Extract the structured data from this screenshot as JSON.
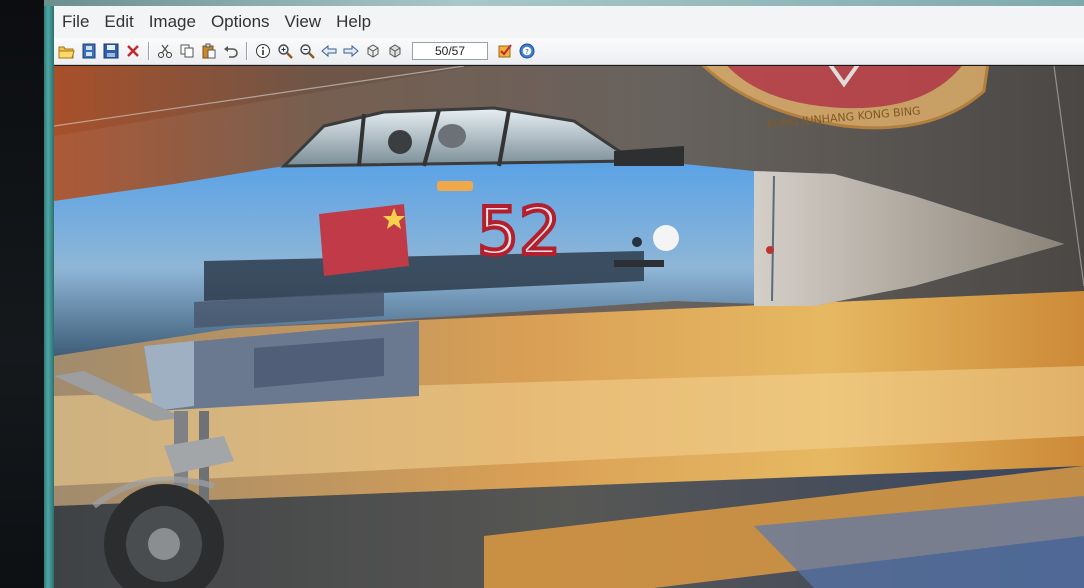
{
  "menu": {
    "items": [
      "File",
      "Edit",
      "Image",
      "Options",
      "View",
      "Help"
    ]
  },
  "toolbar": {
    "counter": "50/57",
    "icons": [
      "open-folder-icon",
      "filmstrip-icon",
      "save-icon",
      "delete-icon",
      "cut-icon",
      "copy-icon",
      "paste-icon",
      "undo-icon",
      "info-icon",
      "zoom-in-icon",
      "zoom-out-icon",
      "previous-arrow-icon",
      "next-arrow-icon",
      "rotate-left-icon",
      "rotate-right-icon",
      "settings-check-icon",
      "help-icon"
    ]
  },
  "image": {
    "aircraft_number": "52",
    "emblem_text": "KONG JUNHANG KONG BING"
  },
  "colors": {
    "frame": "#4ea9a5",
    "menubar": "#f3f4f6",
    "jet_blue": "#5f9fdc",
    "numeral_red": "#b21f2e",
    "flame": "#f1a53a"
  }
}
